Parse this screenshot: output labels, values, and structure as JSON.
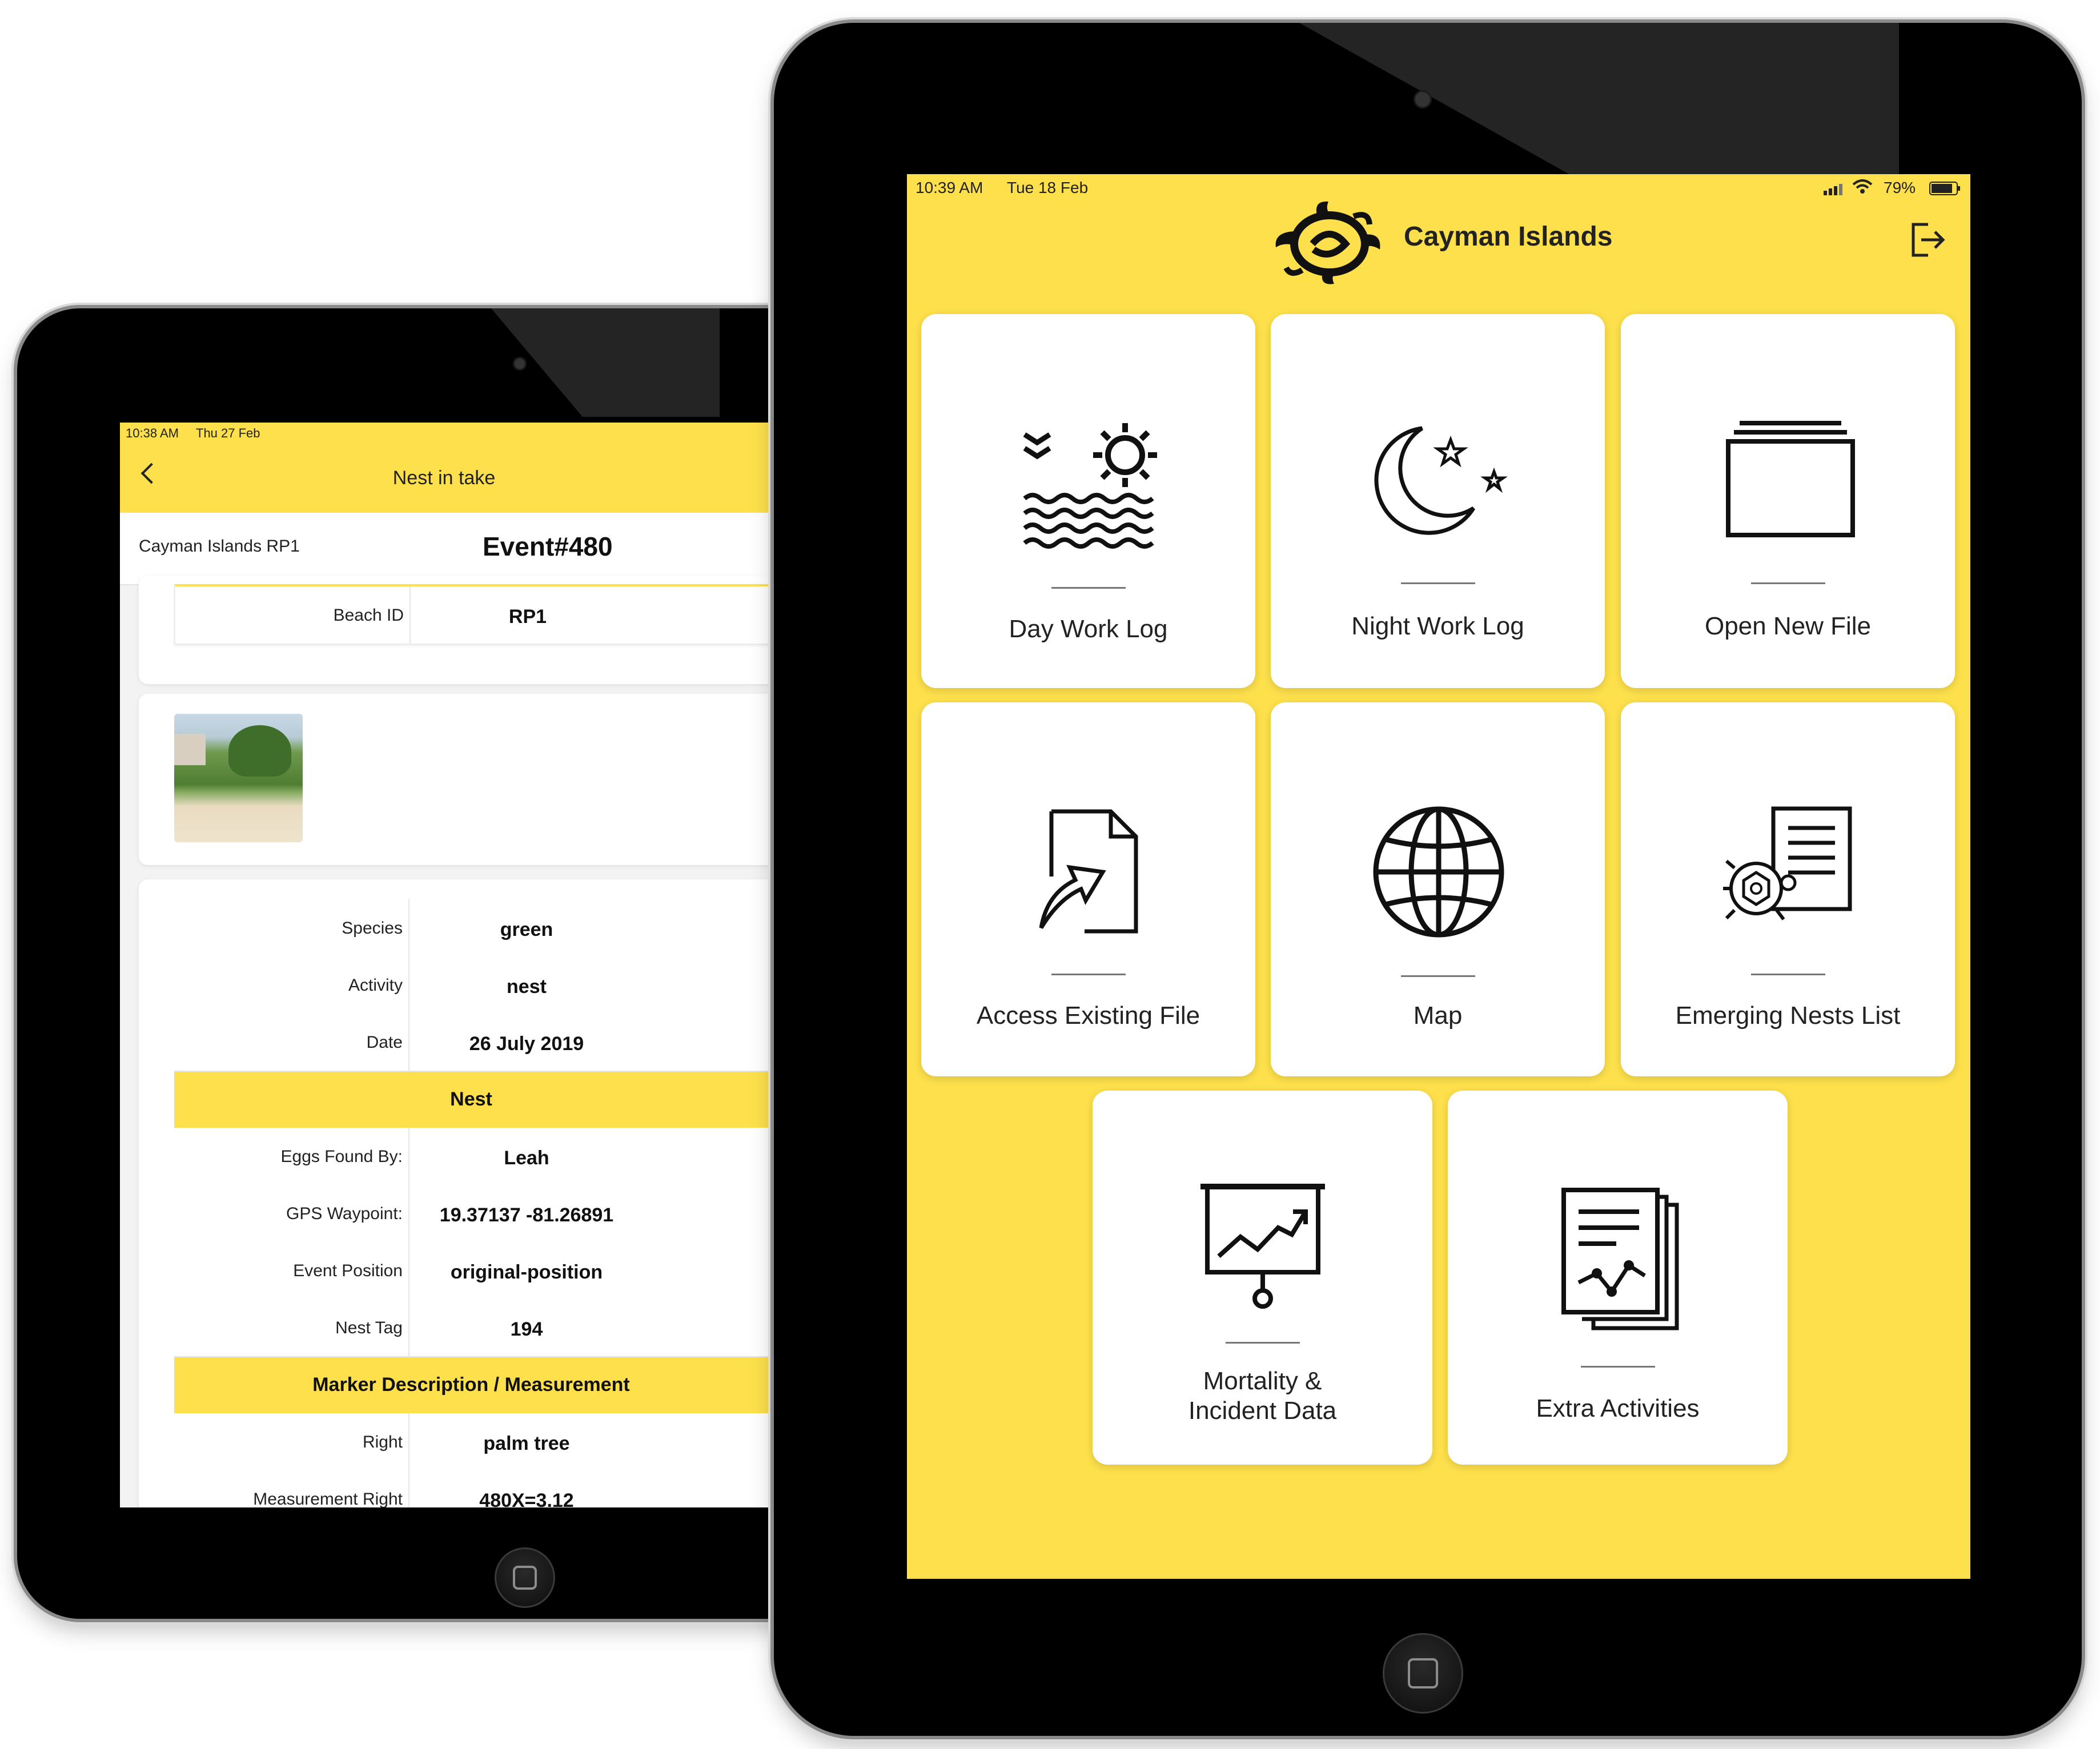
{
  "back_device": {
    "status_time": "10:38 AM",
    "status_date": "Thu 27 Feb",
    "nav_title": "Nest in take",
    "header_left": "Cayman Islands RP1",
    "header_event": "Event#480",
    "beach_id": {
      "label": "Beach ID",
      "value": "RP1"
    },
    "photo_alt": "beach-photo",
    "rows_group1": [
      {
        "label": "Species",
        "value": "green"
      },
      {
        "label": "Activity",
        "value": "nest"
      },
      {
        "label": "Date",
        "value": "26 July 2019"
      }
    ],
    "section_nest": "Nest",
    "rows_group2": [
      {
        "label": "Eggs Found By:",
        "value": "Leah"
      },
      {
        "label": "GPS Waypoint:",
        "value": "19.37137 -81.26891"
      },
      {
        "label": "Event Position",
        "value": "original-position"
      },
      {
        "label": "Nest Tag",
        "value": "194"
      }
    ],
    "section_marker": "Marker Description / Measurement",
    "rows_group3": [
      {
        "label": "Right",
        "value": "palm tree"
      },
      {
        "label": "Measurement Right",
        "value": "480X=3.12"
      }
    ]
  },
  "front_device": {
    "status_time": "10:39 AM",
    "status_date": "Tue 18 Feb",
    "battery": "79%",
    "app_title": "Cayman Islands",
    "tiles": [
      {
        "label": "Day Work Log",
        "icon": "day-sun-waves-icon"
      },
      {
        "label": "Night Work Log",
        "icon": "moon-stars-icon"
      },
      {
        "label": "Open New File",
        "icon": "folder-stack-icon"
      },
      {
        "label": "Access Existing File",
        "icon": "file-upload-icon"
      },
      {
        "label": "Map",
        "icon": "globe-icon"
      },
      {
        "label": "Emerging Nests List",
        "icon": "turtle-list-icon"
      },
      {
        "label_line1": "Mortality &",
        "label_line2": "Incident Data",
        "icon": "presentation-chart-icon"
      },
      {
        "label": "Extra Activities",
        "icon": "report-chart-icon"
      }
    ]
  },
  "colors": {
    "brand_yellow": "#fde04b",
    "frame_black": "#000000",
    "text_dark": "#222222"
  }
}
